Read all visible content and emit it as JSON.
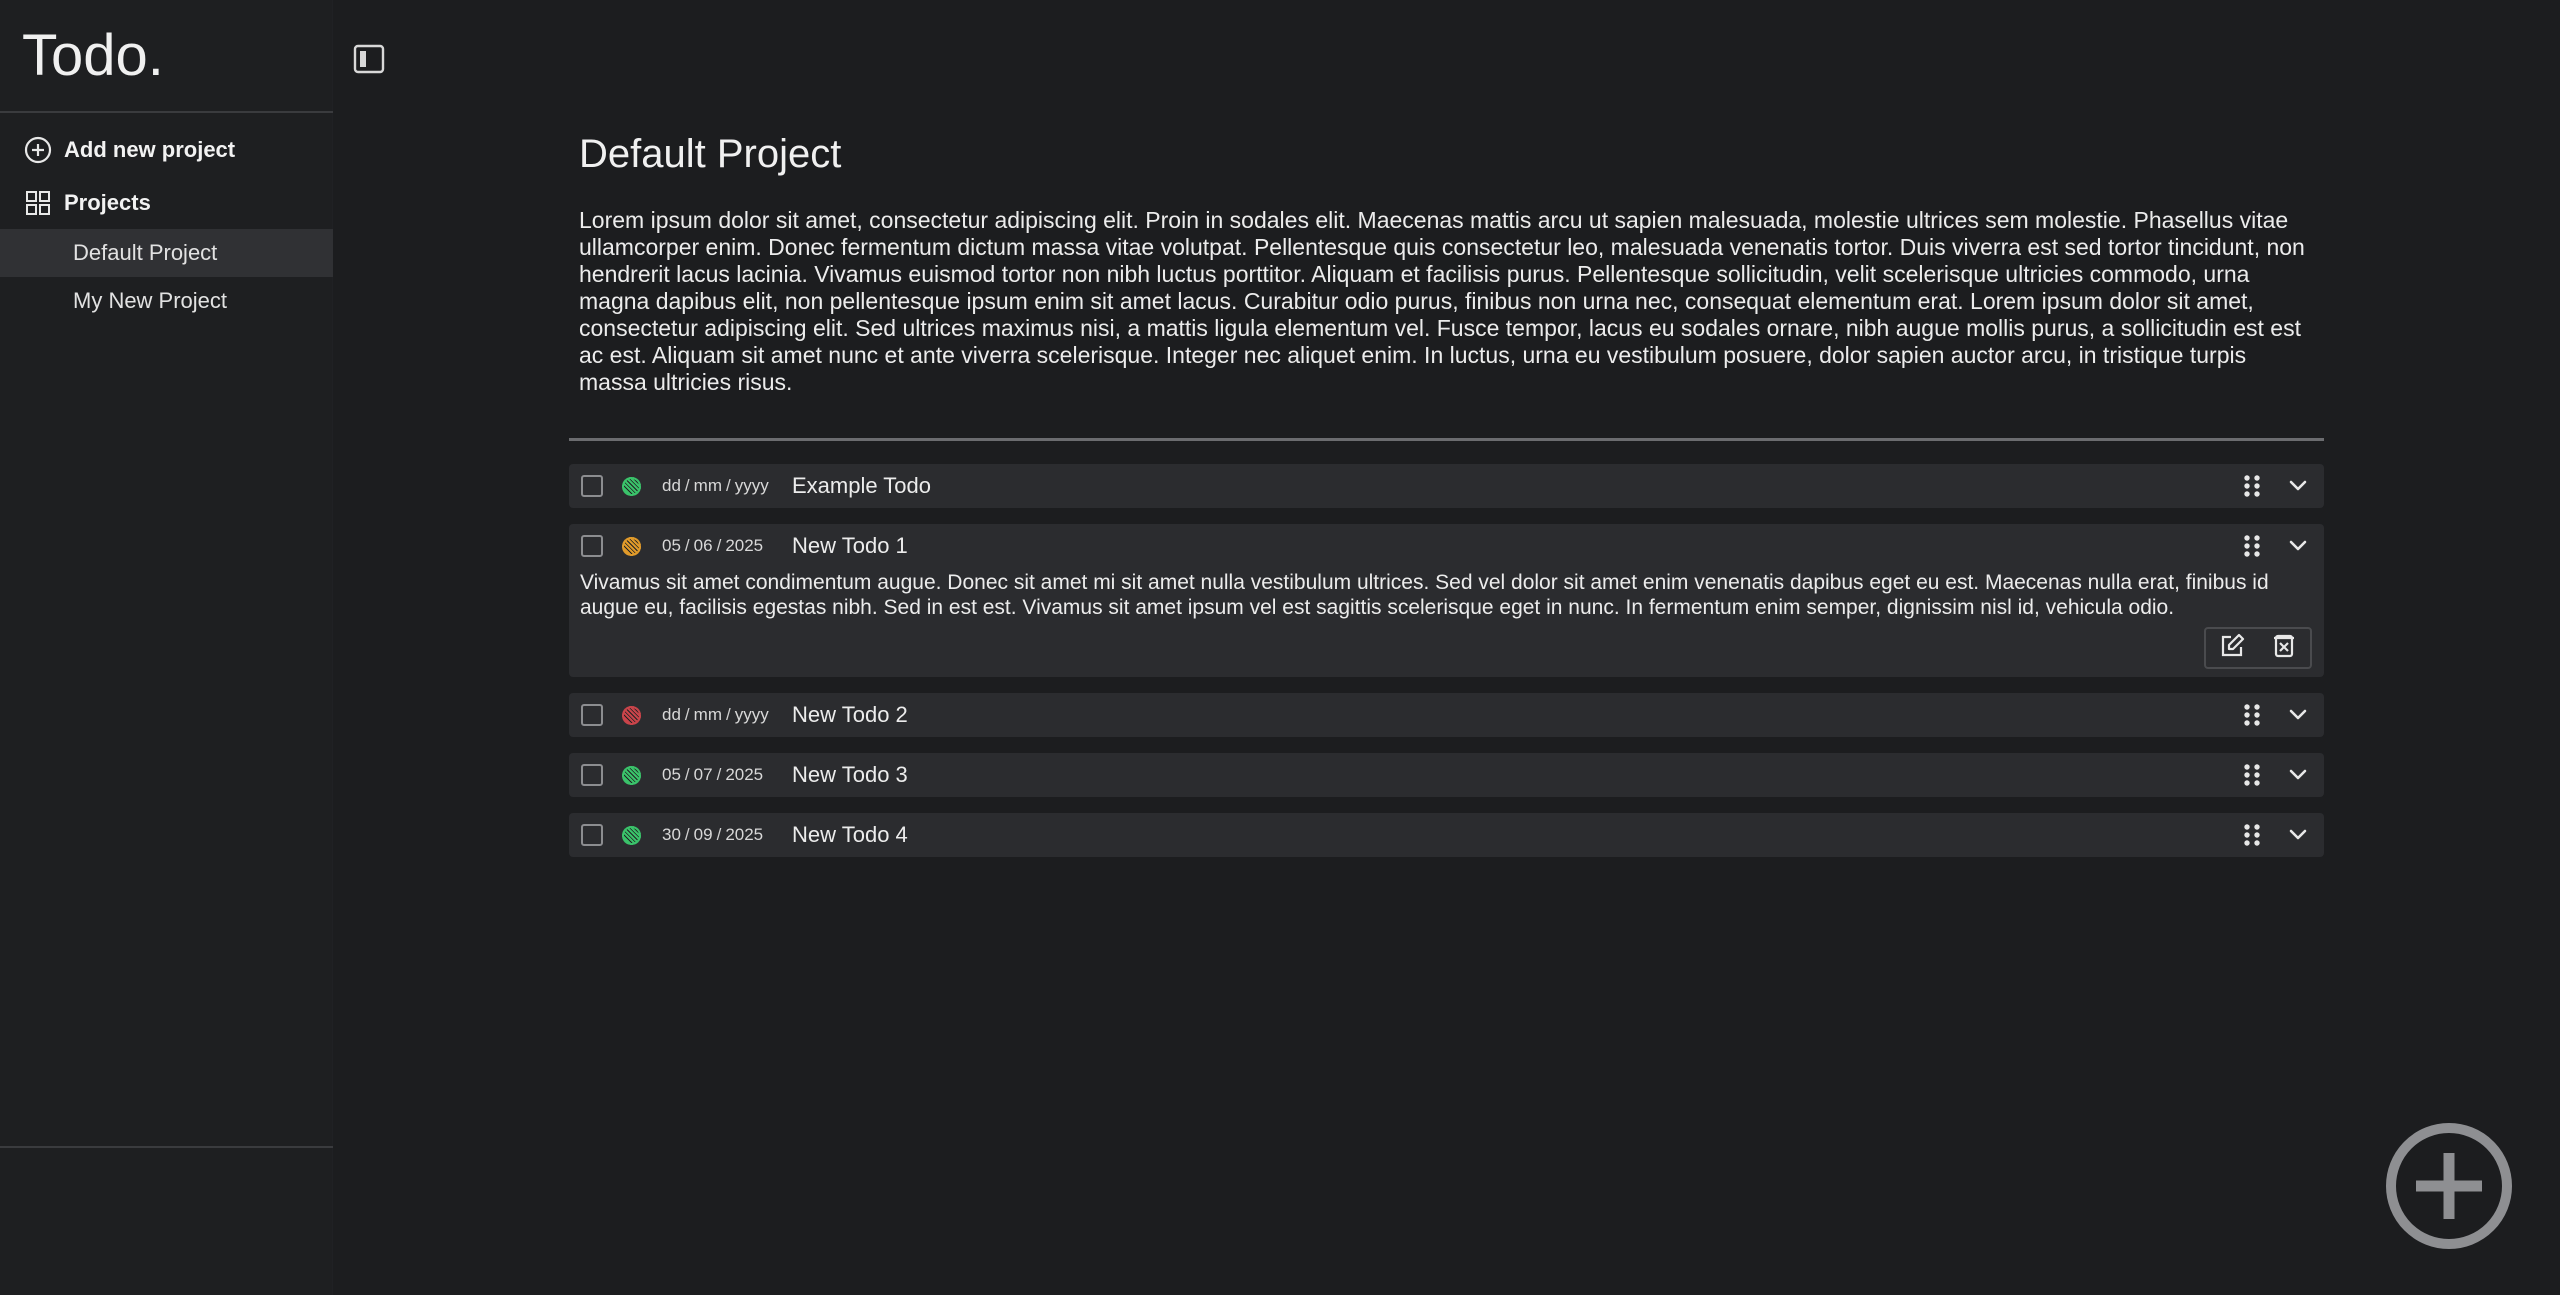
{
  "app": {
    "title": "Todo."
  },
  "sidebar": {
    "add_project_label": "Add new project",
    "projects_label": "Projects",
    "projects": [
      {
        "label": "Default Project",
        "active": true
      },
      {
        "label": "My New Project",
        "active": false
      }
    ]
  },
  "project": {
    "title": "Default Project",
    "description": "Lorem ipsum dolor sit amet, consectetur adipiscing elit. Proin in sodales elit. Maecenas mattis arcu ut sapien malesuada, molestie ultrices sem molestie. Phasellus vitae ullamcorper enim. Donec fermentum dictum massa vitae volutpat. Pellentesque quis consectetur leo, malesuada venenatis tortor. Duis viverra est sed tortor tincidunt, non hendrerit lacus lacinia. Vivamus euismod tortor non nibh luctus porttitor. Aliquam et facilisis purus. Pellentesque sollicitudin, velit scelerisque ultricies commodo, urna magna dapibus elit, non pellentesque ipsum enim sit amet lacus. Curabitur odio purus, finibus non urna nec, consequat elementum erat. Lorem ipsum dolor sit amet, consectetur adipiscing elit. Sed ultrices maximus nisi, a mattis ligula elementum vel. Fusce tempor, lacus eu sodales ornare, nibh augue mollis purus, a sollicitudin est est ac est. Aliquam sit amet nunc et ante viverra scelerisque. Integer nec aliquet enim. In luctus, urna eu vestibulum posuere, dolor sapien auctor arcu, in tristique turpis massa ultricies risus."
  },
  "colors": {
    "priority_low": "#3ac26a",
    "priority_medium": "#e09a2a",
    "priority_high": "#c9444a"
  },
  "todos": [
    {
      "title": "Example Todo",
      "priority": "low",
      "date": {
        "d": "dd",
        "m": "mm",
        "y": "yyyy"
      },
      "checked": false,
      "expanded": false,
      "description": ""
    },
    {
      "title": "New Todo 1",
      "priority": "medium",
      "date": {
        "d": "05",
        "m": "06",
        "y": "2025"
      },
      "checked": false,
      "expanded": true,
      "description": "Vivamus sit amet condimentum augue. Donec sit amet mi sit amet nulla vestibulum ultrices. Sed vel dolor sit amet enim venenatis dapibus eget eu est. Maecenas nulla erat, finibus id augue eu, facilisis egestas nibh. Sed in est est. Vivamus sit amet ipsum vel est sagittis scelerisque eget in nunc. In fermentum enim semper, dignissim nisl id, vehicula odio."
    },
    {
      "title": "New Todo 2",
      "priority": "high",
      "date": {
        "d": "dd",
        "m": "mm",
        "y": "yyyy"
      },
      "checked": false,
      "expanded": false,
      "description": ""
    },
    {
      "title": "New Todo 3",
      "priority": "low",
      "date": {
        "d": "05",
        "m": "07",
        "y": "2025"
      },
      "checked": false,
      "expanded": false,
      "description": ""
    },
    {
      "title": "New Todo 4",
      "priority": "low",
      "date": {
        "d": "30",
        "m": "09",
        "y": "2025"
      },
      "checked": false,
      "expanded": false,
      "description": ""
    }
  ],
  "date_separator": "/",
  "icons": {
    "add_project": "plus-circle-icon",
    "projects": "grid-icon",
    "toggle_sidebar": "sidebar-toggle-icon",
    "drag": "drag-handle-icon",
    "expand": "chevron-down-icon",
    "edit": "edit-icon",
    "delete": "delete-icon",
    "fab": "plus-circle-icon"
  }
}
